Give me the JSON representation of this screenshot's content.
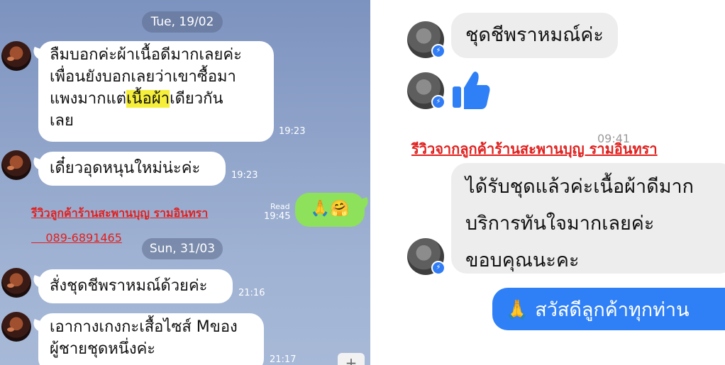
{
  "line_chat": {
    "date_1": "Tue, 19/02",
    "msg_1": {
      "part_a": "ลืมบอกค่ะผ้าเนื้อดีมากเลยค่ะ",
      "part_b": "เพื่อนยังบอกเลยว่าเขาซื้อมา",
      "part_c": "แพงมากแต่",
      "highlight": "เนื้อผ้า",
      "part_d": "เดียวกัน",
      "part_e": "เลย",
      "time": "19:23"
    },
    "msg_2": {
      "text": "เดี๋ยวอุดหนุนใหม่น่ะค่ะ",
      "time": "19:23"
    },
    "reply": {
      "emoji": "🙏🤗",
      "read_label": "Read",
      "time": "19:45"
    },
    "review_label": "รีวิวลูกค้าร้านสะพานบุญ รามอินทรา",
    "phone": "089-6891465",
    "date_2": "Sun, 31/03",
    "msg_3": {
      "text": "สั่งชุดชีพราหมณ์ด้วยค่ะ",
      "time": "21:16"
    },
    "msg_4": {
      "line_1": "เอากางเกงกะเสื้อไซส์ Mของ",
      "line_2": "ผู้ชายชุดหนึ่งค่ะ",
      "time": "21:17"
    },
    "plus": "+"
  },
  "messenger_chat": {
    "msg_1": "ชุดชีพราหมณ์ค่ะ",
    "thumb": "like-thumb-icon",
    "time": "09:41",
    "review_label": "รีวิวจากลูกค้าร้านสะพานบุญ รามอินทรา",
    "msg_2": {
      "line_1": "ได้รับชุดแล้วค่ะเนื้อผ้าดีมาก",
      "line_2": "บริการทันใจมากเลยค่ะ",
      "line_3": "ขอบคุณนะคะ"
    },
    "reply": {
      "emoji": "🙏",
      "text": "สวัสดีลูกค้าทุกท่าน"
    },
    "badge_icon": "messenger-icon"
  },
  "colors": {
    "line_bg": "#8ea2c9",
    "line_out": "#8ee15a",
    "review_red": "#e0211f",
    "messenger_blue": "#2f80f7"
  }
}
